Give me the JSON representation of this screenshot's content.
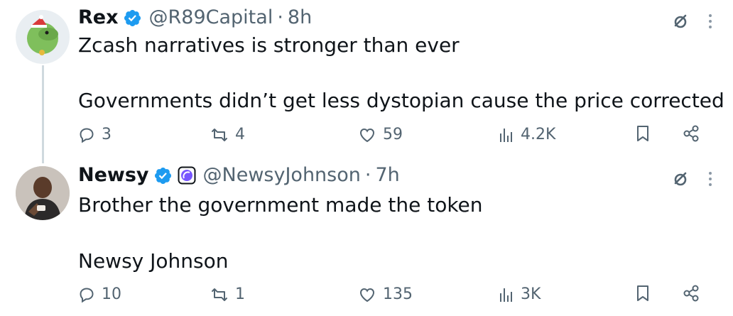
{
  "tweets": [
    {
      "name": "Rex",
      "handle": "@R89Capital",
      "dot": "·",
      "time": "8h",
      "text_lines": [
        "Zcash narratives is stronger than ever",
        "Governments didn’t get less dystopian cause the price corrected"
      ],
      "replies": "3",
      "reposts": "4",
      "likes": "59",
      "views": "4.2K"
    },
    {
      "name": "Newsy",
      "handle": "@NewsyJohnson",
      "dot": "·",
      "time": "7h",
      "text_lines": [
        "Brother the government made the token",
        "Newsy Johnson"
      ],
      "replies": "10",
      "reposts": "1",
      "likes": "135",
      "views": "3K"
    }
  ],
  "colors": {
    "verified": "#1d9bf0",
    "muted": "#536471",
    "thread_line": "#cfd9de",
    "affiliate": "#7856ff"
  },
  "icons": [
    "verified-badge-icon",
    "grok-icon",
    "more-icon",
    "reply-icon",
    "repost-icon",
    "like-icon",
    "views-icon",
    "bookmark-icon",
    "share-icon",
    "affiliate-badge-icon"
  ]
}
